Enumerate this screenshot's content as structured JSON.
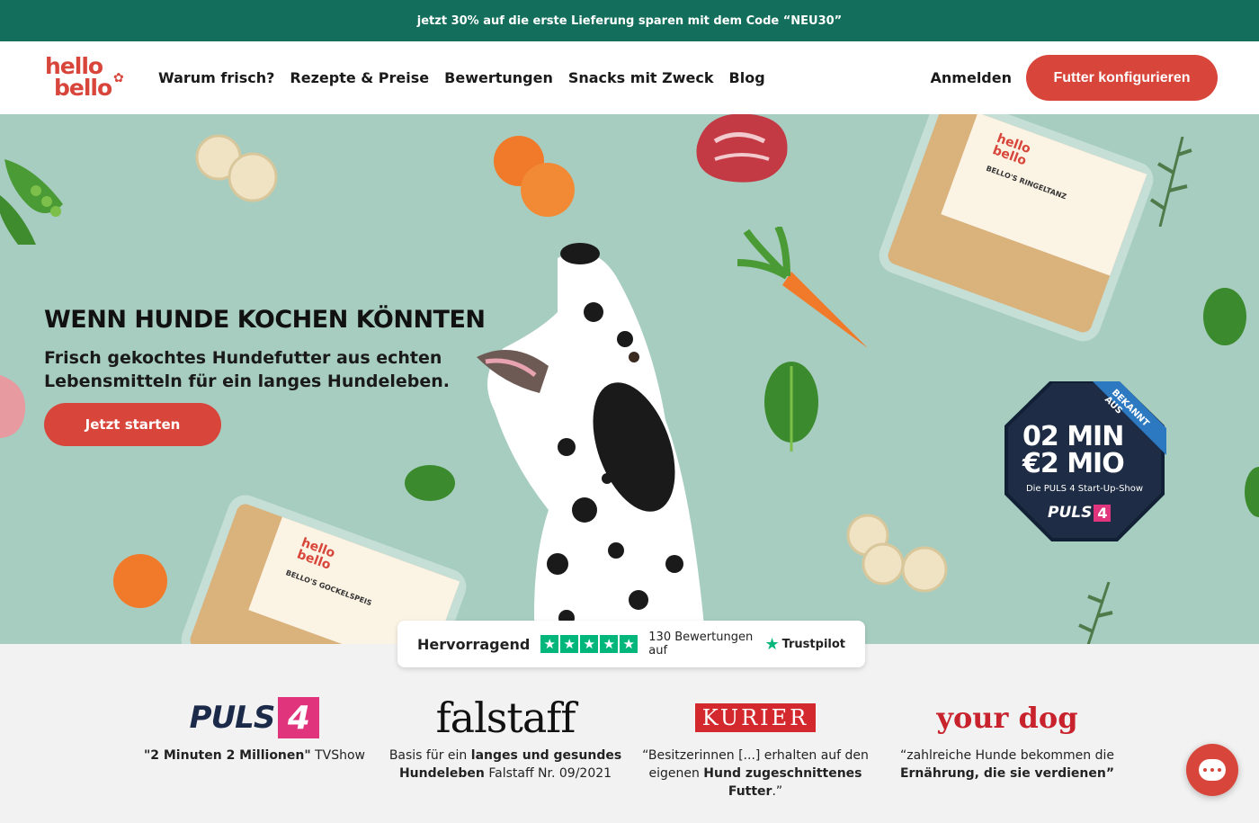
{
  "promo": {
    "text": "jetzt 30% auf die erste Lieferung sparen mit dem Code “NEU30”"
  },
  "header": {
    "logo_top": "hello",
    "logo_bottom": "bello",
    "nav": [
      "Warum frisch?",
      "Rezepte & Preise",
      "Bewertungen",
      "Snacks mit Zweck",
      "Blog"
    ],
    "login": "Anmelden",
    "cta": "Futter konfigurieren"
  },
  "hero": {
    "title": "WENN HUNDE KOCHEN KÖNNTEN",
    "subtitle": "Frisch gekochtes Hundefutter aus echten Lebensmitteln für ein langes Hundeleben.",
    "button": "Jetzt starten",
    "pack_top_brand": "hello bello",
    "pack_top_name": "BELLO'S RINGELTANZ",
    "pack_bottom_brand": "hello bello",
    "pack_bottom_name": "BELLO'S GOCKELSPEIS",
    "badge": {
      "ribbon": "BEKANNT AUS",
      "line1": "02 MIN",
      "line2": "€2 MIO",
      "caption": "Die PULS 4 Start-Up-Show",
      "brand": "PULS",
      "brand_num": "4"
    }
  },
  "trustpilot": {
    "rating_label": "Hervorragend",
    "stars": 5,
    "count_text": "130 Bewertungen auf",
    "brand": "Trustpilot"
  },
  "press": [
    {
      "logo": "PULS",
      "logo_num": "4",
      "bold": "\"2 Minuten 2 Millionen\"",
      "text": " TVShow"
    },
    {
      "logo": "falstaff",
      "pre": "Basis für ein ",
      "bold": "langes und gesundes Hundeleben",
      "text": " Falstaff Nr. 09/2021"
    },
    {
      "logo": "KURIER",
      "pre": "“Besitzerinnen [...] erhalten auf den eigenen ",
      "bold": "Hund zugeschnittenes Futter",
      "text": ".”"
    },
    {
      "logo": "your dog",
      "pre": "“zahlreiche Hunde bekommen die ",
      "bold": "Ernährung, die sie verdienen”",
      "text": ""
    }
  ],
  "colors": {
    "brand_red": "#d8453a",
    "promo_green": "#136e5c",
    "hero_bg": "#a7cdc0",
    "trustpilot_green": "#00b67a"
  }
}
